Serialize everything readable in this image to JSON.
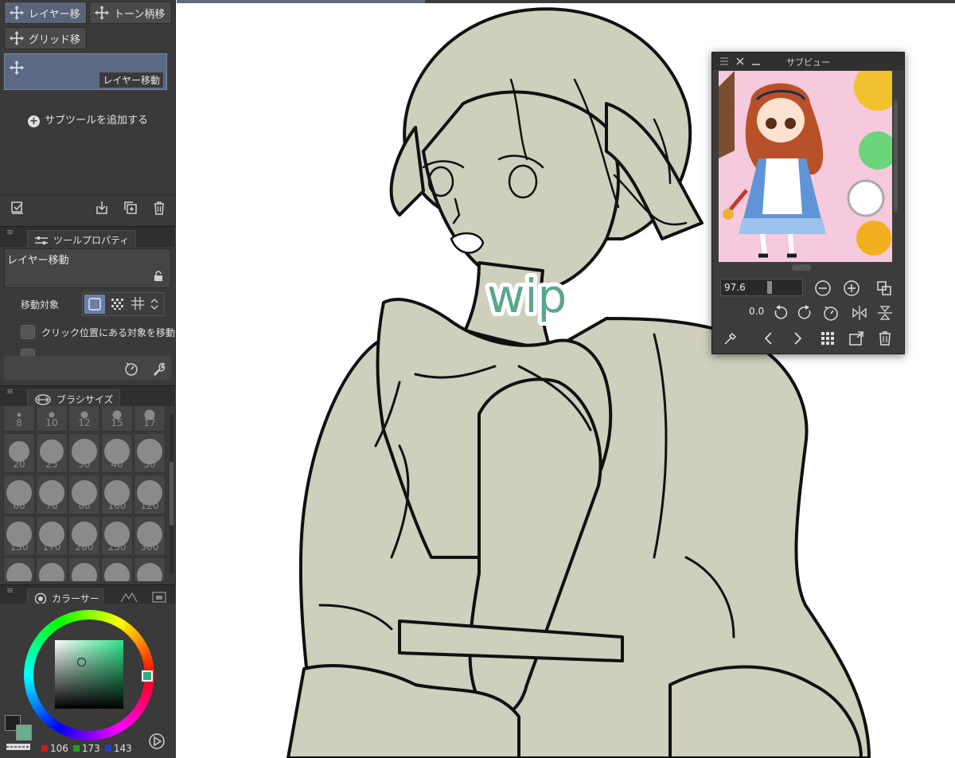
{
  "subtool": {
    "buttons": [
      "レイヤー移",
      "トーン柄移",
      "グリッド移"
    ],
    "selected_label": "レイヤー移動",
    "add_label": "サブツールを追加する"
  },
  "tool_property": {
    "tab_label": "ツールプロパティ",
    "title": "レイヤー移動",
    "move_target_label": "移動対象",
    "checkbox_label": "クリック位置にある対象を移動"
  },
  "brush_size": {
    "tab_label": "ブラシサイズ",
    "rows": [
      [
        "8",
        "10",
        "12",
        "15",
        "17"
      ],
      [
        "20",
        "25",
        "30",
        "40",
        "50"
      ],
      [
        "60",
        "70",
        "80",
        "100",
        "120"
      ],
      [
        "150",
        "170",
        "200",
        "250",
        "300"
      ]
    ]
  },
  "color": {
    "tab_label": "カラーサー",
    "r": "106",
    "g": "173",
    "b": "143",
    "main_color": "#1f1f1f",
    "sub_color": "#6aad8f"
  },
  "subview": {
    "title": "サブビュー",
    "zoom": "97.6",
    "rotation": "0.0"
  },
  "canvas": {
    "wip_text": "wip",
    "line_color": "#111111",
    "fill_color": "#cfcfbd"
  }
}
